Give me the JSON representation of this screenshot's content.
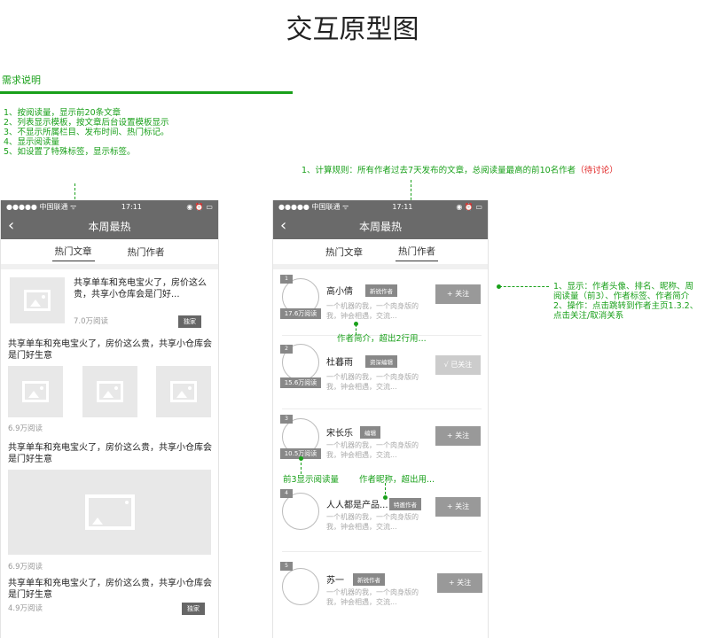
{
  "page": {
    "title": "交互原型图",
    "requirements": {
      "heading": "需求说明",
      "items": [
        "1、按阅读量，显示前20条文章",
        "2、列表显示模板，按文章后台设置模板显示",
        "3、不显示所属栏目、发布时间、热门标记。",
        "4、显示阅读量",
        "5、如设置了特殊标签，显示标签。"
      ]
    },
    "rule_note": {
      "text": "1、计算规则：所有作者过去7天发布的文章，总阅读量最高的前10名作者",
      "pending": "（待讨论）"
    },
    "display_note": [
      "1、显示：作者头像、排名、昵称、周",
      "阅读量（前3）、作者标签、作者简介",
      "2、操作：点击跳转到作者主页1.3.2、",
      "点击关注/取消关系"
    ],
    "bio_note": "作者简介，超出2行用...",
    "reads_note": "前3显示阅读量",
    "nick_note": "作者昵称，超出用..."
  },
  "phone": {
    "status": {
      "carrier": "●●●●● 中国联通 ᯤ",
      "time": "17:11",
      "battery": "◉ ⏰ ▭"
    },
    "nav_title": "本周最热",
    "tabs": [
      "热门文章",
      "热门作者"
    ]
  },
  "articles": [
    {
      "title": "共享单车和充电宝火了，房价这么贵，共享小仓库会是门好...",
      "reads": "7.0万阅读",
      "tag": "独家"
    },
    {
      "title": "共享单车和充电宝火了，房价这么贵，共享小仓库会是门好生意",
      "reads": "6.9万阅读"
    },
    {
      "title": "共享单车和充电宝火了，房价这么贵，共享小仓库会是门好生意",
      "reads": "6.9万阅读"
    },
    {
      "title": "共享单车和充电宝火了，房价这么贵，共享小仓库会是门好生意",
      "reads": "4.9万阅读",
      "tag": "独家"
    }
  ],
  "authors": [
    {
      "rank": "1",
      "name": "高小倩",
      "tag": "新锐作者",
      "reads": "17.6万阅读",
      "desc": "一个机器的我，一个肉身版的我，钟会相遇，交流...",
      "follow": "+ 关注"
    },
    {
      "rank": "2",
      "name": "杜暮雨",
      "tag": "资深编辑",
      "reads": "15.6万阅读",
      "desc": "一个机器的我，一个肉身版的我，钟会相遇，交流...",
      "follow": "√ 已关注"
    },
    {
      "rank": "3",
      "name": "宋长乐",
      "tag": "编辑",
      "reads": "10.5万阅读",
      "desc": "一个机器的我，一个肉身版的我，钟会相遇，交流...",
      "follow": "+ 关注"
    },
    {
      "rank": "4",
      "name": "人人都是产品...",
      "tag": "特邀作者",
      "desc": "一个机器的我，一个肉身版的我，钟会相遇，交流...",
      "follow": "+ 关注"
    },
    {
      "rank": "5",
      "name": "苏一",
      "tag": "新锐作者",
      "desc": "一个机器的我，一个肉身版的我，钟会相遇，交流...",
      "follow": "+ 关注"
    }
  ]
}
